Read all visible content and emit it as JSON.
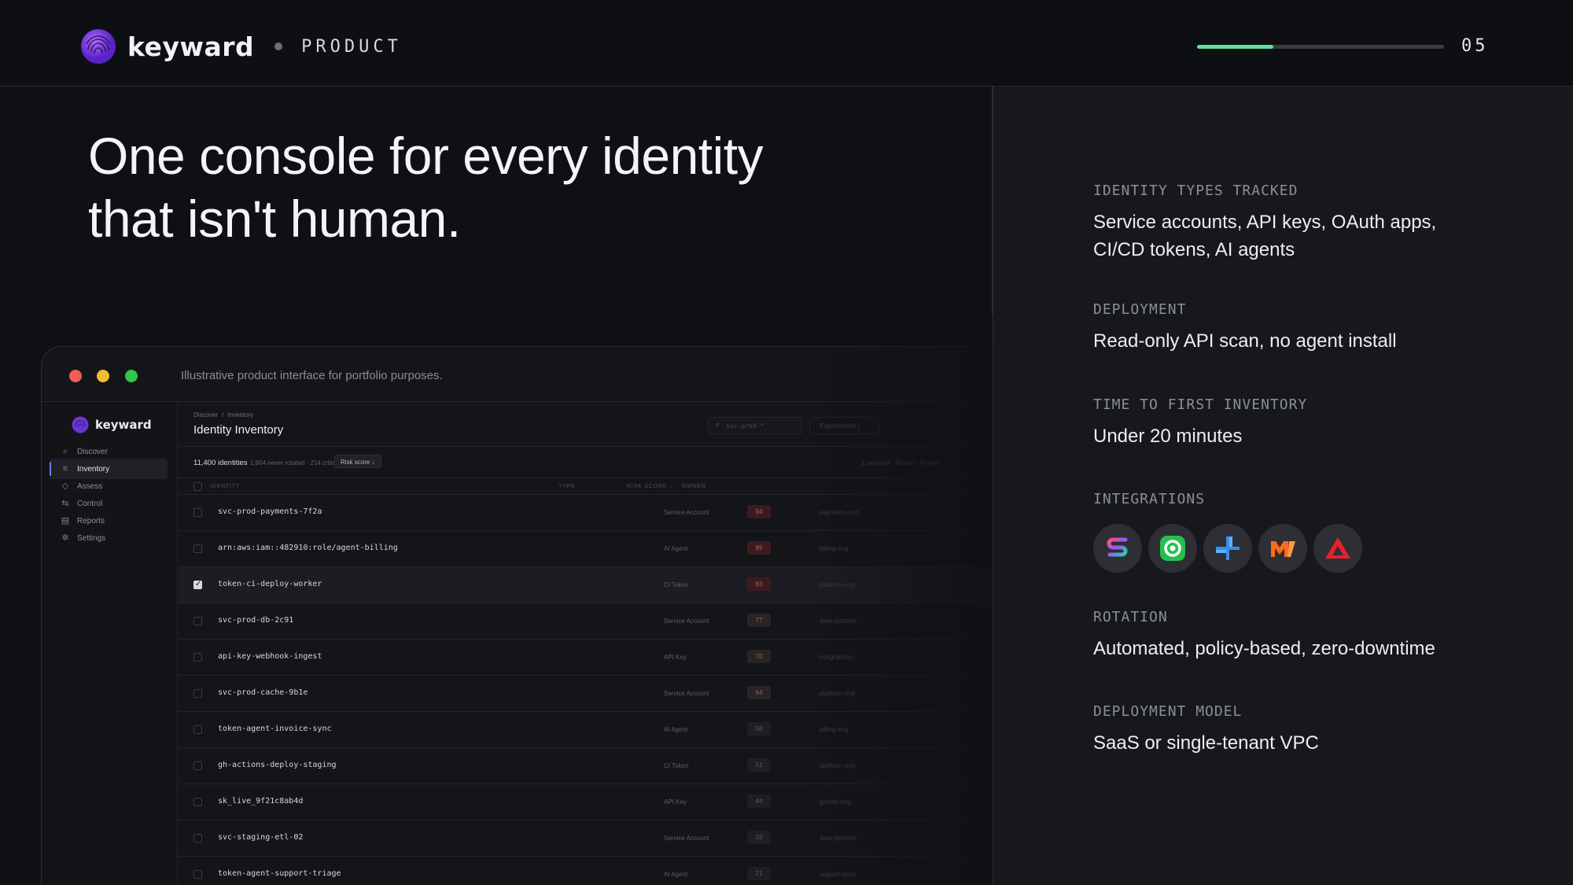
{
  "header": {
    "brand": "keyward",
    "section": "PRODUCT",
    "page_number": "05",
    "progress": 0.31,
    "progress_color": "#5fe0a0"
  },
  "hero": {
    "headline_line1": "One console for every identity",
    "headline_line2": "that isn't human."
  },
  "window": {
    "caption": "Illustrative product interface for portfolio purposes.",
    "brand": "keyward",
    "sidebar": [
      {
        "label": "Discover",
        "icon": "search-icon",
        "active": false
      },
      {
        "label": "Inventory",
        "icon": "list-icon",
        "active": true
      },
      {
        "label": "Assess",
        "icon": "shield-icon",
        "active": false
      },
      {
        "label": "Control",
        "icon": "sliders-icon",
        "active": false
      },
      {
        "label": "Reports",
        "icon": "document-icon",
        "active": false
      },
      {
        "label": "Settings",
        "icon": "gear-icon",
        "active": false
      }
    ],
    "breadcrumb": [
      "Discover",
      "/",
      "Inventory"
    ],
    "title": "Identity Inventory",
    "search_placeholder": "svc-prod-*",
    "export_label": "Export/report  |",
    "summary_count": "11,400 identities",
    "summary_detail": "· 1,904 never rotated · 214 critical",
    "sort_chip": "Risk score ↓",
    "selection_text": "1 selected · Rotate · Revoke",
    "columns": {
      "identity": "IDENTITY",
      "type": "TYPE",
      "risk": "RISK SCORE ↓",
      "owner": "OWNER"
    },
    "rows": [
      {
        "name": "svc-prod-payments-7f2a",
        "type": "Service Account",
        "score": "94",
        "owner": "payments-eng",
        "checked": false
      },
      {
        "name": "arn:aws:iam::482910:role/agent-billing",
        "type": "AI Agent",
        "score": "89",
        "owner": "billing-eng",
        "checked": false
      },
      {
        "name": "token-ci-deploy-worker",
        "type": "CI Token",
        "score": "83",
        "owner": "platform-eng",
        "checked": true
      },
      {
        "name": "svc-prod-db-2c91",
        "type": "Service Account",
        "score": "77",
        "owner": "data-platform",
        "checked": false
      },
      {
        "name": "api-key-webhook-ingest",
        "type": "API Key",
        "score": "70",
        "owner": "integrations",
        "checked": false
      },
      {
        "name": "svc-prod-cache-9b1e",
        "type": "Service Account",
        "score": "64",
        "owner": "platform-eng",
        "checked": false
      },
      {
        "name": "token-agent-invoice-sync",
        "type": "AI Agent",
        "score": "58",
        "owner": "billing-eng",
        "checked": false
      },
      {
        "name": "gh-actions-deploy-staging",
        "type": "CI Token",
        "score": "51",
        "owner": "platform-eng",
        "checked": false
      },
      {
        "name": "sk_live_9f21c8ab4d",
        "type": "API Key",
        "score": "44",
        "owner": "growth-eng",
        "checked": false
      },
      {
        "name": "svc-staging-etl-02",
        "type": "Service Account",
        "score": "33",
        "owner": "data-platform",
        "checked": false
      },
      {
        "name": "token-agent-support-triage",
        "type": "AI Agent",
        "score": "21",
        "owner": "support-tools",
        "checked": false
      }
    ]
  },
  "specs": [
    {
      "label": "IDENTITY TYPES TRACKED",
      "value_line1": "Service accounts, API keys, OAuth apps,",
      "value_line2": "CI/CD tokens, AI agents"
    },
    {
      "label": "DEPLOYMENT",
      "value": "Read-only API scan, no agent install"
    },
    {
      "label": "TIME TO FIRST INVENTORY",
      "value": "Under 20 minutes"
    },
    {
      "label": "INTEGRATIONS"
    },
    {
      "label": "ROTATION",
      "value": "Automated, policy-based, zero-downtime"
    },
    {
      "label": "DEPLOYMENT MODEL",
      "value": "SaaS or single-tenant VPC"
    }
  ],
  "integrations": [
    {
      "name": "gradient-s-logo-icon"
    },
    {
      "name": "green-swirl-logo-icon"
    },
    {
      "name": "blue-cross-logo-icon"
    },
    {
      "name": "orange-m-logo-icon"
    },
    {
      "name": "red-triangle-logo-icon"
    }
  ],
  "colors": {
    "accent": "#5fe0a0",
    "brand_purple": "#7b3fe4",
    "background": "#0f1013",
    "panel": "#17181c"
  }
}
